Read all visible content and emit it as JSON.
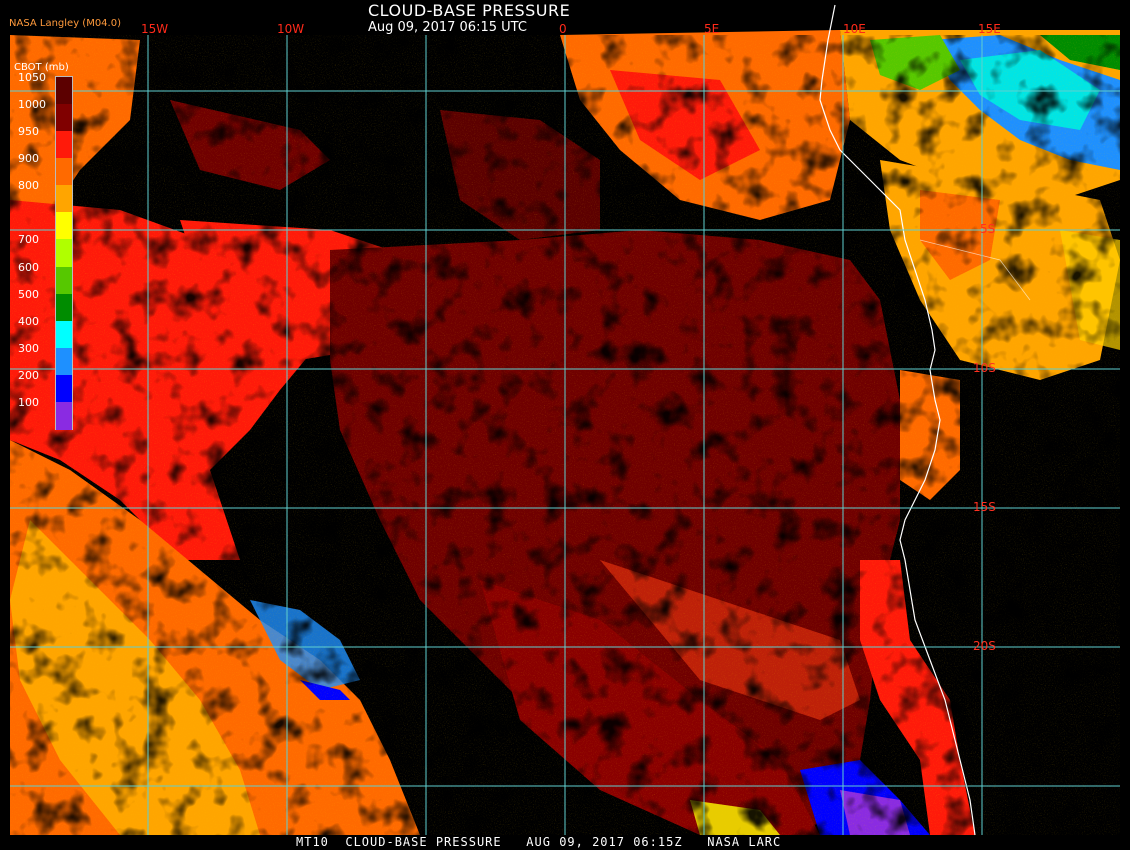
{
  "header": {
    "title": "CLOUD-BASE PRESSURE",
    "datetime": "Aug 09, 2017 06:15 UTC",
    "credit": "NASA Langley (M04.0)"
  },
  "colorbar": {
    "unit_label": "CBOT (mb)",
    "levels": [
      {
        "label": "1050",
        "color": "#5c0000"
      },
      {
        "label": "1000",
        "color": "#800000"
      },
      {
        "label": "950",
        "color": "#ff1a0a"
      },
      {
        "label": "900",
        "color": "#ff6a00"
      },
      {
        "label": "800",
        "color": "#ffa500"
      },
      {
        "label": "",
        "color": "#ffff00"
      },
      {
        "label": "700",
        "color": "#b0ff00"
      },
      {
        "label": "600",
        "color": "#56c800"
      },
      {
        "label": "500",
        "color": "#008c00"
      },
      {
        "label": "400",
        "color": "#00ffff"
      },
      {
        "label": "300",
        "color": "#1e90ff"
      },
      {
        "label": "200",
        "color": "#0000ff"
      },
      {
        "label": "100",
        "color": "#8a2be2"
      }
    ]
  },
  "grid": {
    "longitude_labels": [
      "15W",
      "10W",
      "0",
      "5E",
      "10E",
      "15E"
    ],
    "latitude_labels": [
      "5S",
      "10S",
      "15S",
      "20S"
    ],
    "line_color": "#5fd0d0"
  },
  "legend_meaning": {
    "low_pressure_high_cloud": "100",
    "high_pressure_low_cloud": "1050"
  },
  "footer": {
    "text": "MT10  CLOUD-BASE PRESSURE   AUG 09, 2017 06:15Z   NASA LARC"
  }
}
